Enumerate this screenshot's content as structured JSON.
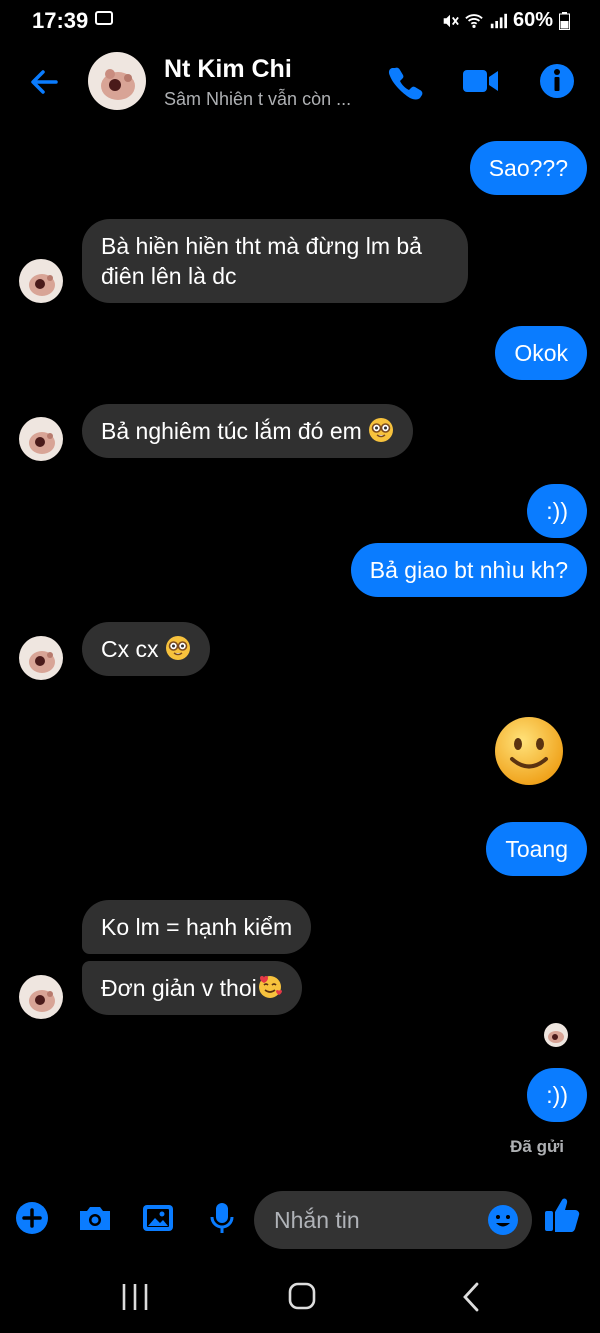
{
  "status_bar": {
    "time": "17:39",
    "battery": "60%"
  },
  "header": {
    "contact_name": "Nt Kim Chi",
    "contact_status": "Sâm Nhiên t vẫn còn  ..."
  },
  "messages": [
    {
      "from": "me",
      "text": "Sao???"
    },
    {
      "from": "them",
      "text": "Bà hiền hiền tht mà đừng lm bả điên lên là dc"
    },
    {
      "from": "me",
      "text": "Okok"
    },
    {
      "from": "them",
      "text": "Bả nghiêm túc lắm đó em",
      "emoji": "nerd-face"
    },
    {
      "from": "me",
      "text": ":))"
    },
    {
      "from": "me",
      "text": "Bả giao bt nhìu kh?"
    },
    {
      "from": "them",
      "text": "Cx cx",
      "emoji": "nerd-face"
    },
    {
      "from": "me",
      "emoji": "slightly-smiling-face"
    },
    {
      "from": "me",
      "text": "Toang"
    },
    {
      "from": "them",
      "text": "Ko lm = hạnh kiểm"
    },
    {
      "from": "them",
      "text": "Đơn giản v thoi",
      "emoji": "smiling-face-with-hearts"
    },
    {
      "from": "me",
      "text": ":))"
    }
  ],
  "delivery_status": "Đã gửi",
  "composer": {
    "placeholder": "Nhắn tin"
  },
  "colors": {
    "sent_bubble": "#0a7cff",
    "received_bubble": "#303030",
    "accent": "#0a7cff",
    "background": "#000000"
  }
}
